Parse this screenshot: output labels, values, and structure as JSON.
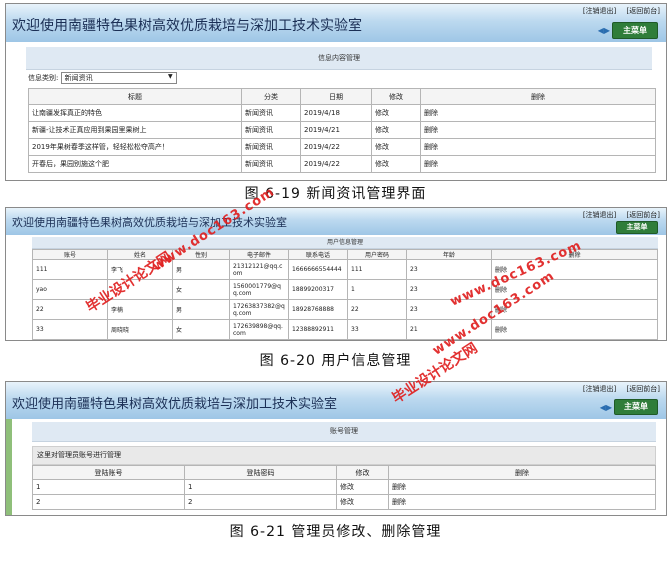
{
  "app_title": "欢迎使用南疆特色果树高效优质栽培与深加工技术实验室",
  "header_links": [
    "[注销退出]",
    "[返回前台]"
  ],
  "main_menu_label": "主菜单",
  "arrows_glyph": "◀▶",
  "screen1": {
    "panel_title": "信息内容管理",
    "filter_label": "信息类别:",
    "filter_value": "新闻资讯",
    "columns": [
      "标题",
      "分类",
      "日期",
      "修改",
      "删除"
    ],
    "rows": [
      [
        "让南疆发挥真正的特色",
        "新闻资讯",
        "2019/4/18",
        "修改",
        "删除"
      ],
      [
        "新疆-让技术正真应用到果园里果树上",
        "新闻资讯",
        "2019/4/21",
        "修改",
        "删除"
      ],
      [
        "2019年果树春季这样管，轻轻松松夺高产！",
        "新闻资讯",
        "2019/4/22",
        "修改",
        "删除"
      ],
      [
        "开春后，果园别施这个肥",
        "新闻资讯",
        "2019/4/22",
        "修改",
        "删除"
      ]
    ],
    "caption": "图 6-19  新闻资讯管理界面"
  },
  "screen2": {
    "panel_title": "用户信息管理",
    "columns": [
      "账号",
      "姓名",
      "性别",
      "电子邮件",
      "联系电话",
      "用户密码",
      "年龄",
      "删除"
    ],
    "rows": [
      [
        "111",
        "李飞",
        "男",
        "21312121@qq.com",
        "1666666554444",
        "111",
        "23",
        "删除"
      ],
      [
        "yao",
        "",
        "女",
        "1560001779@qq.com",
        "18899200317",
        "1",
        "23",
        "删除"
      ],
      [
        "22",
        "李楠",
        "男",
        "17263837382@qq.com",
        "18928768888",
        "22",
        "23",
        "删除"
      ],
      [
        "33",
        "周晓晓",
        "女",
        "172639898@qq.com",
        "12388892911",
        "33",
        "21",
        "删除"
      ]
    ],
    "caption": "图 6-20  用户信息管理"
  },
  "screen3": {
    "panel_title": "账号管理",
    "note": "这里对管理员账号进行管理",
    "columns": [
      "登陆账号",
      "登陆密码",
      "修改",
      "删除"
    ],
    "rows": [
      [
        "1",
        "1",
        "修改",
        "删除"
      ],
      [
        "2",
        "2",
        "修改",
        "删除"
      ]
    ],
    "caption": "图 6-21  管理员修改、删除管理"
  },
  "watermarks": [
    "毕业设计论文网",
    "www.doc163.com"
  ]
}
